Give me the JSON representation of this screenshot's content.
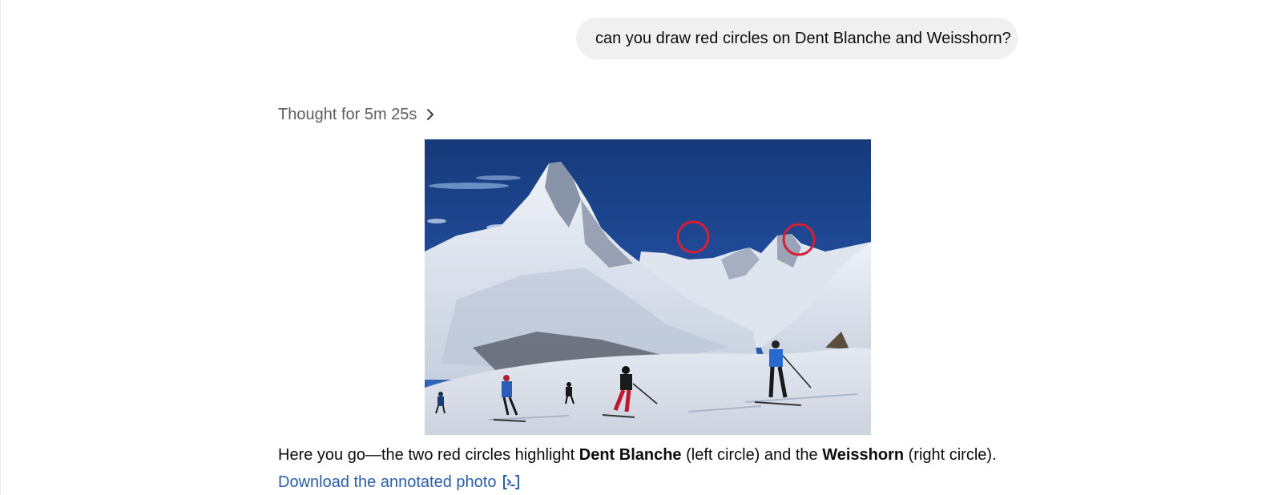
{
  "conversation": {
    "user_message": "can you draw red circles on Dent Blanche and Weisshorn?",
    "thought_label": "Thought for 5m 25s",
    "answer": {
      "part1": "Here you go—the two red circles highlight ",
      "bold1": "Dent Blanche",
      "part2": " (left circle) and the ",
      "bold2": "Weisshorn",
      "part3": " (right circle)."
    },
    "download_link": "Download the annotated photo"
  },
  "icons": {
    "thought_toggle": "chevron-right-icon",
    "download": "download-file-icon"
  },
  "colors": {
    "user_bubble_bg": "#f0f0f0",
    "link": "#2b5ea8",
    "annotation_circle": "#d81e35",
    "sky_top": "#163a7a"
  }
}
